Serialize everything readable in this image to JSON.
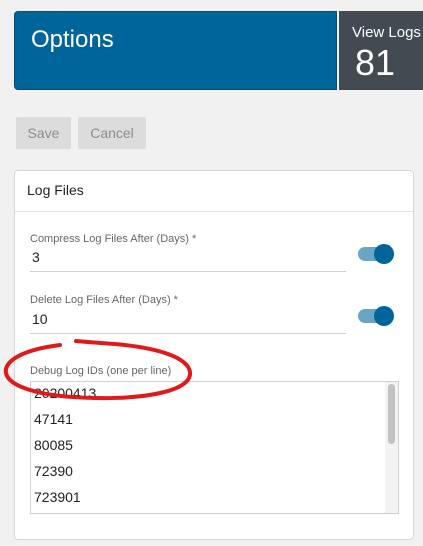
{
  "header": {
    "title": "Options",
    "logs_label": "View Logs",
    "logs_count": "81"
  },
  "toolbar": {
    "save_label": "Save",
    "cancel_label": "Cancel"
  },
  "card": {
    "title": "Log Files",
    "compress": {
      "label": "Compress Log Files After (Days) *",
      "value": "3",
      "enabled": true
    },
    "delete": {
      "label": "Delete Log Files After (Days) *",
      "value": "10",
      "enabled": true
    },
    "debug": {
      "label": "Debug Log IDs (one per line)",
      "lines": [
        "20200413",
        "47141",
        "80085",
        "72390",
        "723901"
      ]
    }
  },
  "colors": {
    "brand": "#00659a",
    "tile_dark": "#434a52",
    "annotation": "#e01a1a"
  }
}
